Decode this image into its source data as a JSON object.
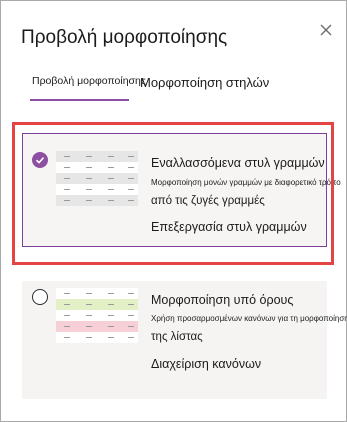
{
  "panel": {
    "title": "Προβολή μορφοποίησης",
    "close_icon": "close-icon"
  },
  "tabs": [
    {
      "label": "Προβολή μορφοποίησης",
      "selected": true
    },
    {
      "label": "Μορφοποίηση στηλών",
      "selected": false
    }
  ],
  "accent_color": "#8c4fa2",
  "highlight_color": "#e34545",
  "options": [
    {
      "title": "Εναλλασσόμενα στυλ γραμμών",
      "description_line1": "Μορφοποίηση μονών γραμμών με διαφορετικό τρόπο",
      "description_line2": "από τις ζυγές γραμμές",
      "action": "Επεξεργασία στυλ γραμμών",
      "selected": true,
      "preview_row_colors": [
        "#e6e6e6",
        "#ffffff",
        "#e6e6e6",
        "#ffffff",
        "#e6e6e6"
      ]
    },
    {
      "title": "Μορφοποίηση υπό όρους",
      "description_line1": "Χρήση προσαρμοσμένων κανόνων για τη μορφοποίηση",
      "description_line2": "της λίστας",
      "action": "Διαχείριση κανόνων",
      "selected": false,
      "preview_row_colors": [
        "#ffffff",
        "#e3f0c6",
        "#ffffff",
        "#f7cfd6",
        "#ffffff"
      ]
    }
  ]
}
